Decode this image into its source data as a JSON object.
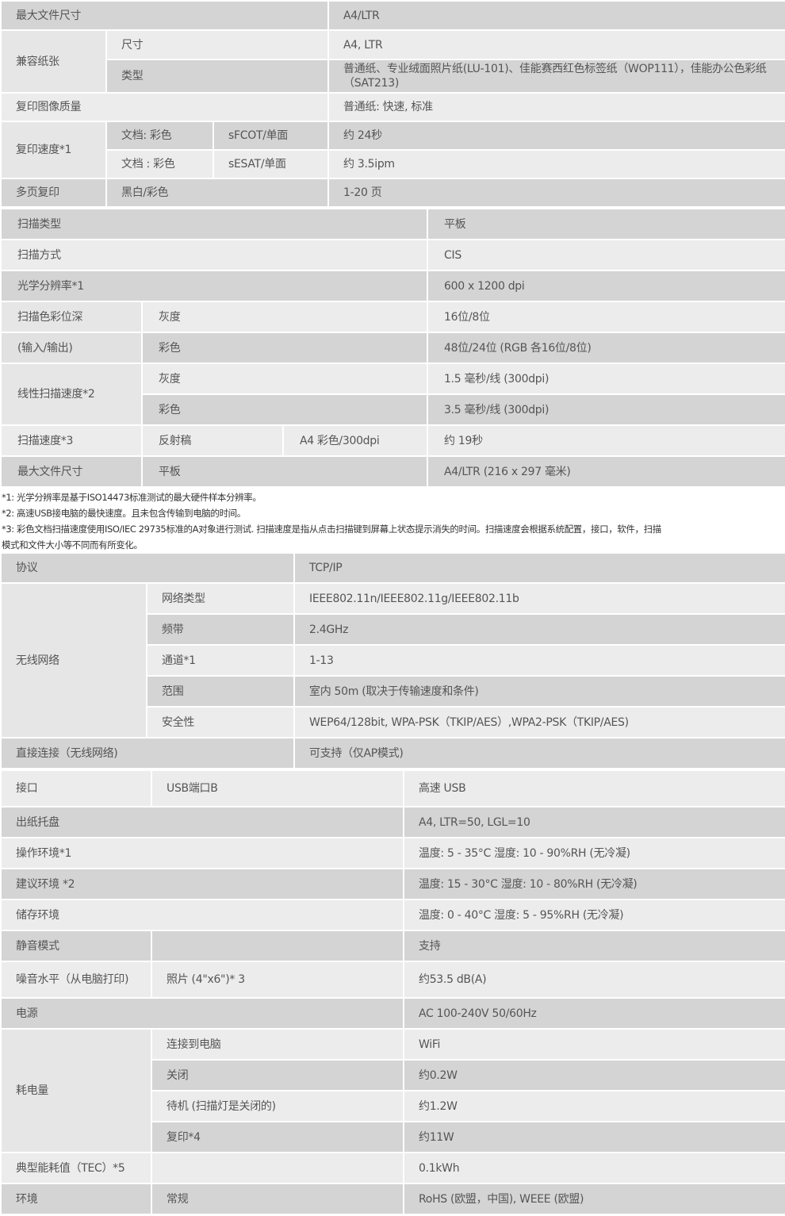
{
  "copy": {
    "max_file_size": {
      "label": "最大文件尺寸",
      "value": "A4/LTR"
    },
    "paper": {
      "label": "兼容纸张",
      "size": {
        "label": "尺寸",
        "value": "A4, LTR"
      },
      "type": {
        "label": "类型",
        "value": "普通纸、专业绒面照片纸(LU-101)、佳能赛西红色标签纸（WOP111），佳能办公色彩纸（SAT213)"
      }
    },
    "quality": {
      "label": "复印图像质量",
      "value": "普通纸: 快速, 标准"
    },
    "speed": {
      "label": "复印速度*1",
      "rows": [
        {
          "doc": "文档: 彩色",
          "mode": "sFCOT/单面",
          "value": "约 24秒"
        },
        {
          "doc": "文档 : 彩色",
          "mode": "sESAT/单面",
          "value": "约 3.5ipm"
        }
      ]
    },
    "multi": {
      "label": "多页复印",
      "sub": "黑白/彩色",
      "value": "1-20 页"
    }
  },
  "scan": {
    "type": {
      "label": "扫描类型",
      "value": "平板"
    },
    "method": {
      "label": "扫描方式",
      "value": "CIS"
    },
    "resolution": {
      "label": "光学分辨率*1",
      "value": "600 x 1200 dpi"
    },
    "depth": {
      "label1": "扫描色彩位深",
      "label2": "(输入/输出)",
      "gray": {
        "label": "灰度",
        "value": "16位/8位"
      },
      "color": {
        "label": "彩色",
        "value": "48位/24位 (RGB 各16位/8位)"
      }
    },
    "line_speed": {
      "label": "线性扫描速度*2",
      "gray": {
        "label": "灰度",
        "value": "1.5 毫秒/线 (300dpi)"
      },
      "color": {
        "label": "彩色",
        "value": "3.5 毫秒/线 (300dpi)"
      }
    },
    "speed": {
      "label": "扫描速度*3",
      "sub": "反射稿",
      "mode": "A4 彩色/300dpi",
      "value": "约 19秒"
    },
    "max_size": {
      "label": "最大文件尺寸",
      "sub": "平板",
      "value": "A4/LTR (216 x 297 毫米)"
    }
  },
  "notes": [
    "*1: 光学分辨率是基于ISO14473标准测试的最大硬件样本分辨率。",
    "*2: 高速USB接电脑的最快速度。且未包含传输到电脑的时间。",
    "*3: 彩色文档扫描速度使用ISO/IEC 29735标准的A对象进行测试. 扫描速度是指从点击扫描键到屏幕上状态提示消失的时间。扫描速度会根据系统配置，接口，软件，扫描",
    "模式和文件大小等不同而有所变化。"
  ],
  "network": {
    "protocol": {
      "label": "协议",
      "value": "TCP/IP"
    },
    "wireless": {
      "label": "无线网络",
      "rows": [
        {
          "label": "网络类型",
          "value": "IEEE802.11n/IEEE802.11g/IEEE802.11b"
        },
        {
          "label": "频带",
          "value": "2.4GHz"
        },
        {
          "label": "通道*1",
          "value": "1-13"
        },
        {
          "label": "范围",
          "value": "室内 50m (取决于传输速度和条件)"
        },
        {
          "label": "安全性",
          "value": "WEP64/128bit, WPA-PSK（TKIP/AES）,WPA2-PSK（TKIP/AES)"
        }
      ]
    },
    "direct": {
      "label": "直接连接（无线网络)",
      "value": "可支持（仅AP模式)"
    }
  },
  "general": {
    "interface": {
      "label": "接口",
      "sub": "USB端口B",
      "value": "高速 USB"
    },
    "tray": {
      "label": "出纸托盘",
      "value": "A4, LTR=50, LGL=10"
    },
    "op_env": {
      "label": "操作环境*1",
      "value": "温度: 5 - 35°C    湿度: 10 - 90%RH (无冷凝)"
    },
    "rec_env": {
      "label": "建议环境 *2",
      "value": "温度: 15 - 30°C    湿度: 10 - 80%RH (无冷凝)"
    },
    "storage": {
      "label": "储存环境",
      "value": "温度: 0 - 40°C    湿度: 5 - 95%RH (无冷凝)"
    },
    "quiet": {
      "label": "静音模式",
      "sub": "",
      "value": "支持"
    },
    "noise": {
      "label": "噪音水平（从电脑打印)",
      "sub": "照片 (4\"x6\")* 3",
      "value": "约53.5 dB(A)"
    },
    "power": {
      "label": "电源",
      "value": "AC 100-240V 50/60Hz"
    },
    "consumption": {
      "label": "耗电量",
      "rows": [
        {
          "label": "连接到电脑",
          "value": "WiFi"
        },
        {
          "label": "关闭",
          "value": "约0.2W"
        },
        {
          "label": "待机 (扫描灯是关闭的)",
          "value": "约1.2W"
        },
        {
          "label": "复印*4",
          "value": "约11W"
        }
      ]
    },
    "tec": {
      "label": "典型能耗值（TEC）*5",
      "sub": "",
      "value": "0.1kWh"
    },
    "env": {
      "label": "环境",
      "sub": "常规",
      "value": "RoHS (欧盟，中国), WEEE (欧盟)"
    }
  }
}
